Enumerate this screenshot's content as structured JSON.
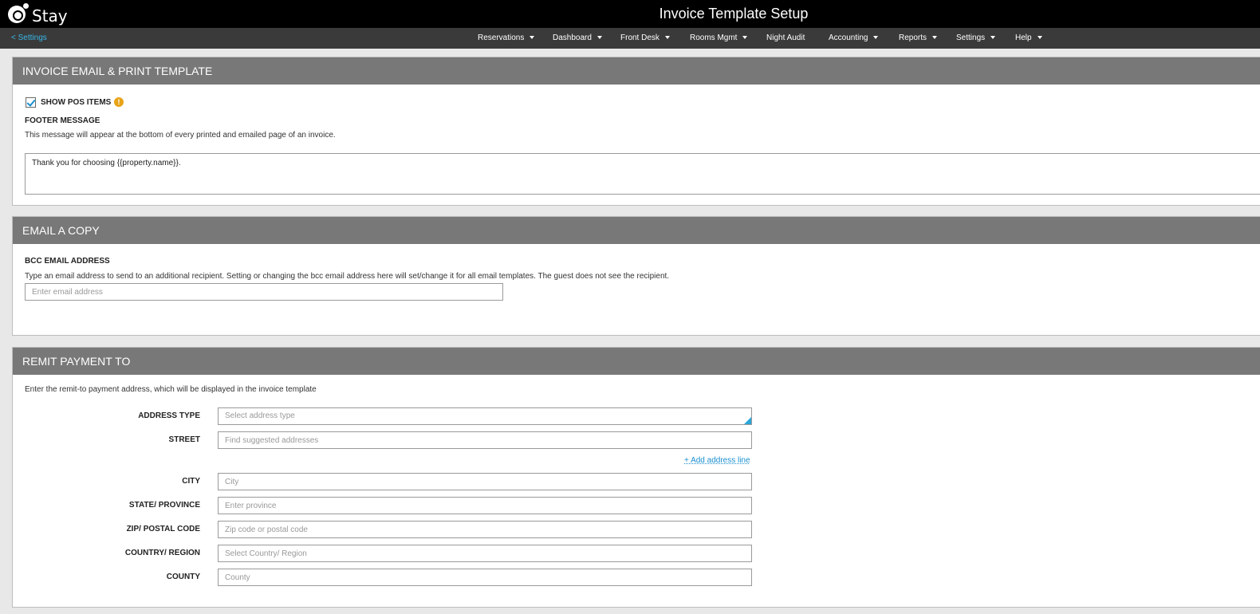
{
  "app": {
    "brand": "Stay",
    "title": "Invoice Template Setup"
  },
  "nav": {
    "back_label": "< Settings",
    "items": [
      {
        "label": "Reservations"
      },
      {
        "label": "Dashboard"
      },
      {
        "label": "Front Desk"
      },
      {
        "label": "Rooms Mgmt"
      },
      {
        "label": "Night Audit"
      },
      {
        "label": "Accounting"
      },
      {
        "label": "Reports"
      },
      {
        "label": "Settings"
      },
      {
        "label": "Help"
      }
    ]
  },
  "invoice_section": {
    "title": "INVOICE EMAIL & PRINT TEMPLATE",
    "show_pos_label": "SHOW POS ITEMS",
    "show_pos_checked": true,
    "info_glyph": "!",
    "footer_label": "FOOTER MESSAGE",
    "footer_hint": "This message will appear at the bottom of every printed and emailed page of an invoice.",
    "footer_value": "Thank you for choosing {{property.name}}."
  },
  "email_section": {
    "title": "EMAIL A COPY",
    "bcc_label": "BCC EMAIL ADDRESS",
    "bcc_hint": "Type an email address to send to an additional recipient. Setting or changing the bcc email address here will set/change it for all email templates. The guest does not see the recipient.",
    "bcc_placeholder": "Enter email address"
  },
  "remit_section": {
    "title": "REMIT PAYMENT TO",
    "hint": "Enter the remit-to payment address, which will be displayed in the invoice template",
    "address_type": {
      "label": "ADDRESS TYPE",
      "placeholder": "Select address type"
    },
    "street": {
      "label": "STREET",
      "placeholder": "Find suggested addresses"
    },
    "add_line": "+ Add address line",
    "city": {
      "label": "CITY",
      "placeholder": "City"
    },
    "state": {
      "label": "STATE/ PROVINCE",
      "placeholder": "Enter province"
    },
    "zip": {
      "label": "ZIP/ POSTAL CODE",
      "placeholder": "Zip code or postal code"
    },
    "country": {
      "label": "COUNTRY/ REGION",
      "placeholder": "Select Country/ Region"
    },
    "county": {
      "label": "COUNTY",
      "placeholder": "County"
    }
  },
  "colors": {
    "topbar": "#000000",
    "navbar": "#3a3a3a",
    "section_header": "#787878",
    "link": "#39b6e6",
    "info": "#e8a317"
  }
}
